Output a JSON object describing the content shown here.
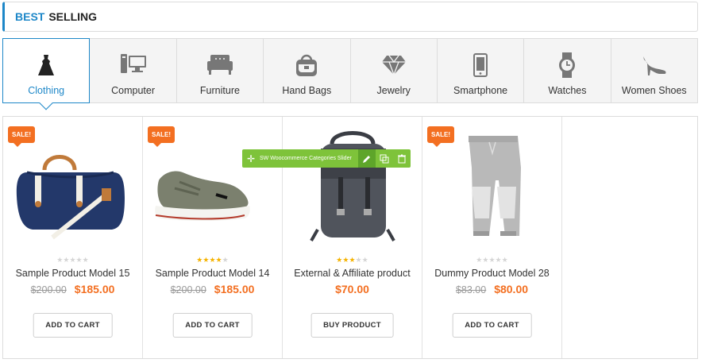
{
  "header": {
    "title_accent": "BEST",
    "title_rest": "SELLING",
    "accent_color": "#1d87c8"
  },
  "categories": [
    {
      "label": "Clothing",
      "icon": "dress-icon",
      "active": true
    },
    {
      "label": "Computer",
      "icon": "computer-icon"
    },
    {
      "label": "Furniture",
      "icon": "sofa-icon"
    },
    {
      "label": "Hand Bags",
      "icon": "handbag-icon"
    },
    {
      "label": "Jewelry",
      "icon": "diamond-icon"
    },
    {
      "label": "Smartphone",
      "icon": "smartphone-icon"
    },
    {
      "label": "Watches",
      "icon": "watch-icon"
    },
    {
      "label": "Women Shoes",
      "icon": "high-heel-icon"
    }
  ],
  "editor": {
    "title": "SW Woocommerce Categories Slider"
  },
  "products": [
    {
      "name": "Sample Product Model 15",
      "old_price": "$200.00",
      "price": "$185.00",
      "sale": "SALE!",
      "rating": 0,
      "button": "ADD TO CART",
      "image": "duffel-bag"
    },
    {
      "name": "Sample Product Model 14",
      "old_price": "$200.00",
      "price": "$185.00",
      "sale": "SALE!",
      "rating": 4,
      "button": "ADD TO CART",
      "image": "sneaker"
    },
    {
      "name": "External & Affiliate product",
      "old_price": "",
      "price": "$70.00",
      "sale": "",
      "rating": 3,
      "button": "BUY PRODUCT",
      "image": "backpack"
    },
    {
      "name": "Dummy Product Model 28",
      "old_price": "$83.00",
      "price": "$80.00",
      "sale": "SALE!",
      "rating": 0,
      "button": "ADD TO CART",
      "image": "jogger-pants"
    }
  ],
  "colors": {
    "sale": "#f36f21",
    "price": "#f36f21",
    "star": "#f5b301",
    "editor": "#7ec33a"
  }
}
